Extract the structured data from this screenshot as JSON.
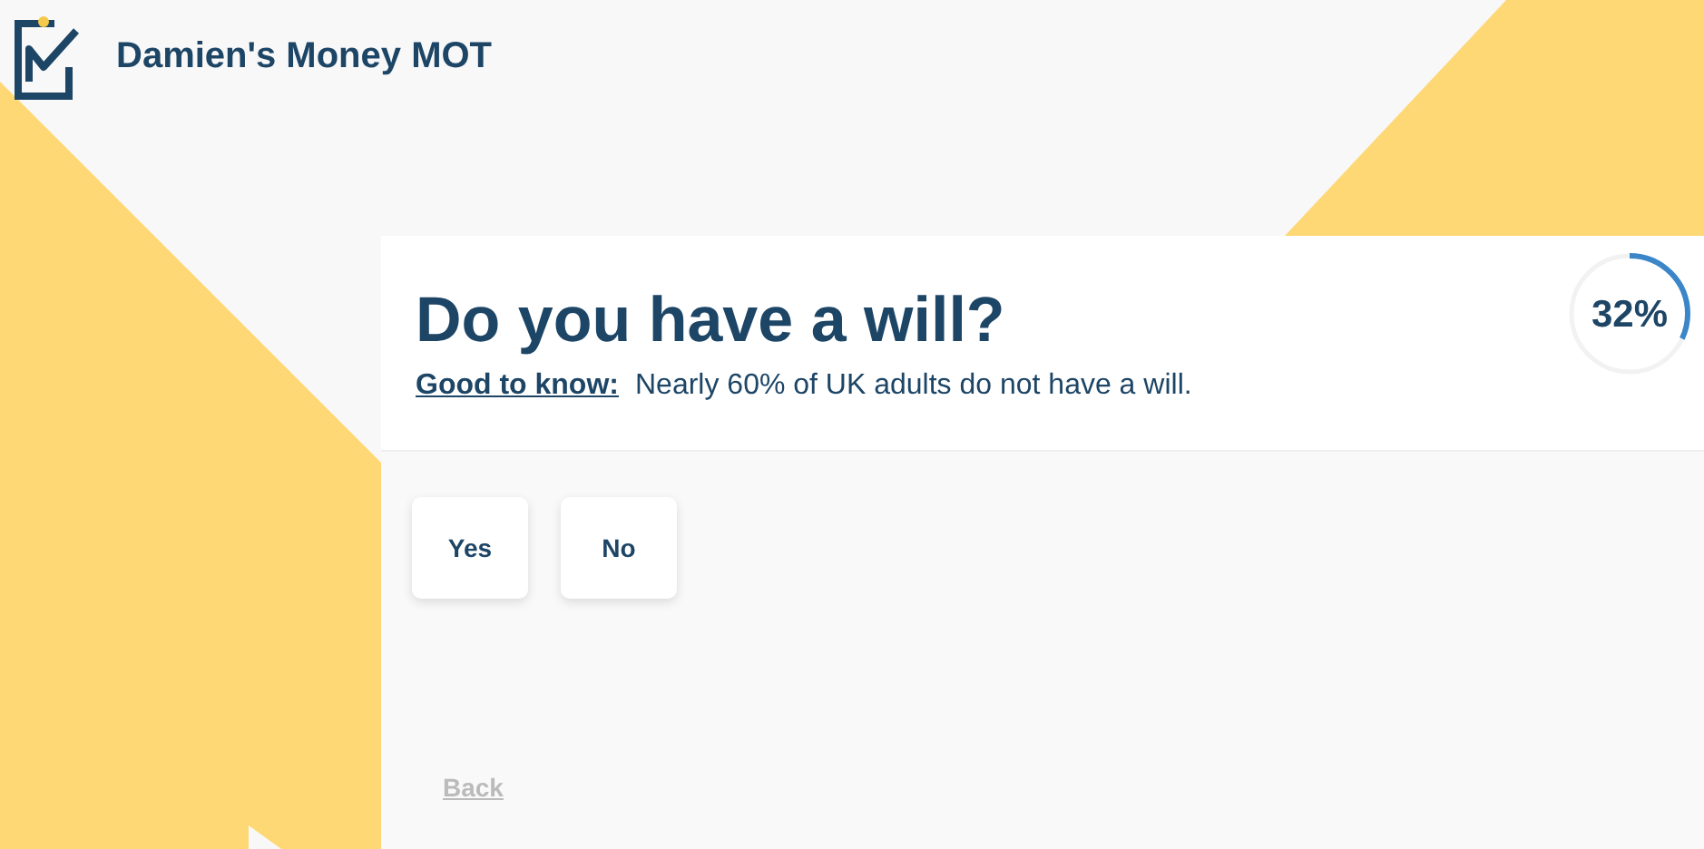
{
  "header": {
    "title": "Damien's Money MOT"
  },
  "question": {
    "title": "Do you have a will?",
    "hint_label": "Good to know:",
    "hint_text": "Nearly 60% of UK adults do not have a will."
  },
  "progress": {
    "reading": "32%",
    "level": 0.32
  },
  "answers": [
    {
      "label": "Yes"
    },
    {
      "label": "No"
    }
  ],
  "back_link": "Back"
}
